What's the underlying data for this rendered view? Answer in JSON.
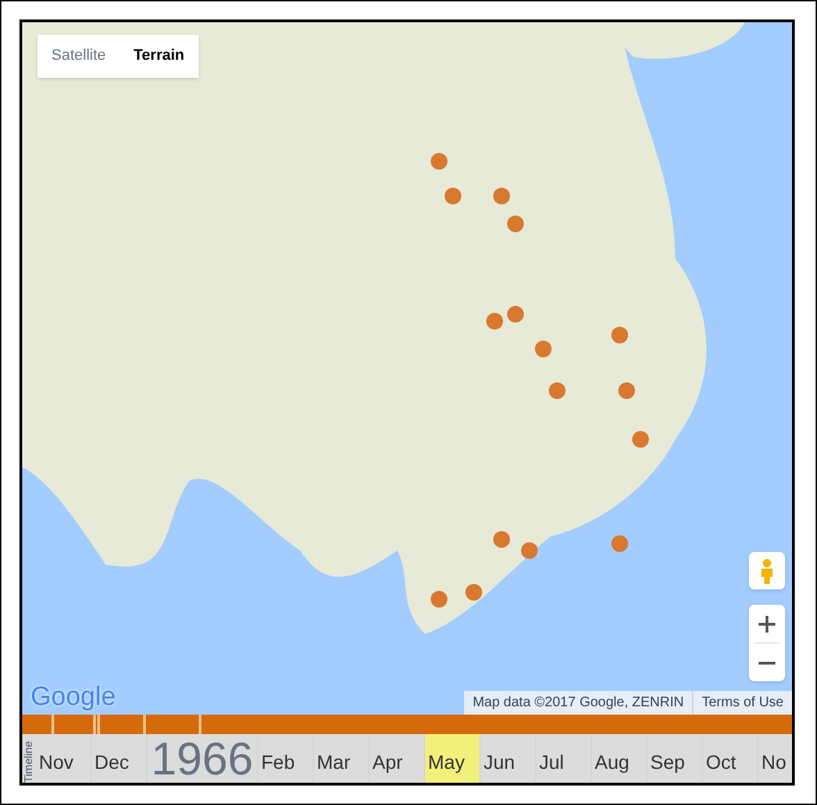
{
  "map_type_tabs": [
    {
      "label": "Satellite",
      "selected": false
    },
    {
      "label": "Terrain",
      "selected": true
    }
  ],
  "logo": "Google",
  "attribution": {
    "map_data": "Map data ©2017 Google, ZENRIN",
    "terms": "Terms of Use"
  },
  "timeline": {
    "label": "Timeline",
    "year": "1966",
    "months_before_year": [
      {
        "label": "Nov",
        "selected": false
      },
      {
        "label": "Dec",
        "selected": false
      }
    ],
    "months_after_year": [
      {
        "label": "Feb",
        "selected": false
      },
      {
        "label": "Mar",
        "selected": false
      },
      {
        "label": "Apr",
        "selected": false
      },
      {
        "label": "May",
        "selected": true
      },
      {
        "label": "Jun",
        "selected": false
      },
      {
        "label": "Jul",
        "selected": false
      },
      {
        "label": "Aug",
        "selected": false
      },
      {
        "label": "Sep",
        "selected": false
      },
      {
        "label": "Oct",
        "selected": false
      },
      {
        "label": "No",
        "selected": false
      }
    ]
  }
}
